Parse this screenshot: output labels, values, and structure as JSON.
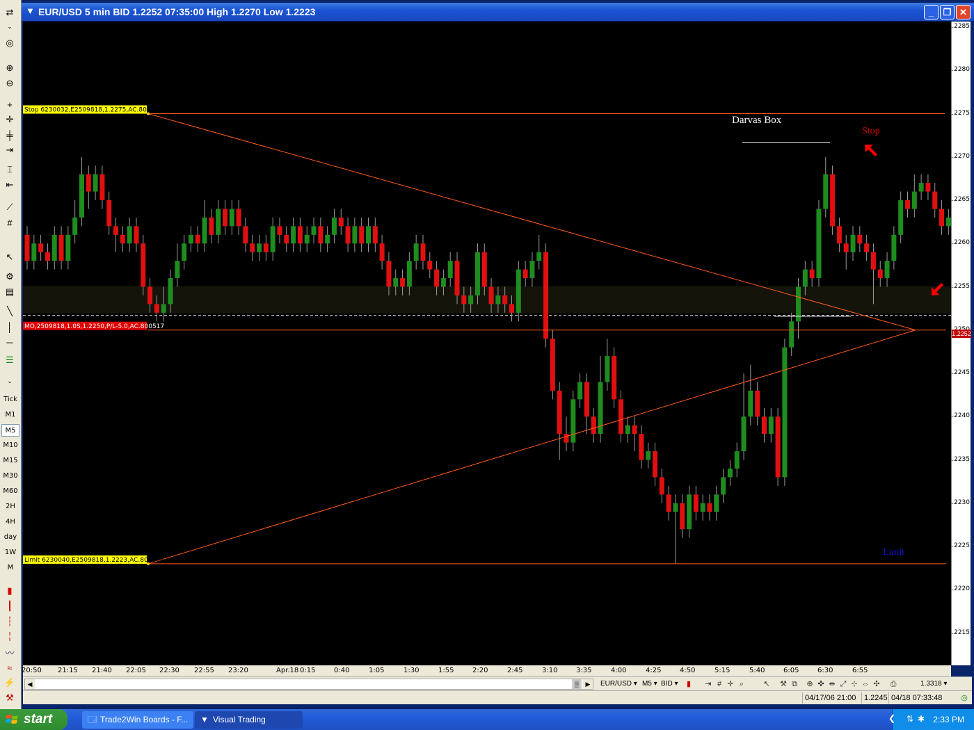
{
  "window": {
    "title": "EUR/USD 5 min BID 1.2252 07:35:00 High 1.2270 Low 1.2223",
    "minimize": "_",
    "restore": "❐",
    "close": "✕"
  },
  "toolbar": {
    "timeframes": [
      "Tick",
      "M1",
      "M5",
      "M10",
      "M15",
      "M30",
      "M60",
      "2H",
      "4H",
      "day",
      "1W",
      "M"
    ],
    "active_timeframe": "M5"
  },
  "chart": {
    "price_ticks": [
      "1.2285",
      "1.2280",
      "1.2275",
      "1.2270",
      "1.2265",
      "1.2260",
      "1.2255",
      "1.2250",
      "1.2245",
      "1.2240",
      "1.2235",
      "1.2230",
      "1.2225",
      "1.2220",
      "1.2215"
    ],
    "current_price": "1.2252",
    "time_ticks": [
      "20:50",
      "21:15",
      "21:40",
      "22:05",
      "22:30",
      "22:55",
      "23:20",
      "Apr.18",
      "0:15",
      "0:40",
      "1:05",
      "1:30",
      "1:55",
      "2:20",
      "2:45",
      "3:10",
      "3:35",
      "4:00",
      "4:25",
      "4:50",
      "5:15",
      "5:40",
      "6:05",
      "6:30",
      "6:55"
    ],
    "stop_label": "Stop 6230032,E2509818,1.2275,AC.800517",
    "order_label": "MO,2509818,1.0S,1.2250,P/L-5.0,AC.800517",
    "limit_label": "Limit 6230040,E2509818,1.2223,AC.800517",
    "annotation_darvas": "Darvas Box",
    "annotation_stop": "Stop",
    "annotation_limit": "Limit",
    "colors": {
      "up": "#1e8c1e",
      "down": "#e01010",
      "line": "#ff5a1e",
      "bg": "#000000"
    }
  },
  "chart_data": {
    "type": "candlestick",
    "title": "EUR/USD 5 min BID",
    "ylim": [
      1.2213,
      1.2286
    ],
    "candles": [
      [
        1.2261,
        1.2258,
        1.2262,
        1.2257
      ],
      [
        1.2258,
        1.226,
        1.2261,
        1.2257
      ],
      [
        1.226,
        1.2259,
        1.2261,
        1.2258
      ],
      [
        1.2259,
        1.2258,
        1.226,
        1.2257
      ],
      [
        1.2258,
        1.2261,
        1.2262,
        1.2257
      ],
      [
        1.2261,
        1.2258,
        1.2262,
        1.2257
      ],
      [
        1.2258,
        1.2261,
        1.2262,
        1.2257
      ],
      [
        1.2261,
        1.2263,
        1.2265,
        1.226
      ],
      [
        1.2263,
        1.2268,
        1.227,
        1.2262
      ],
      [
        1.2268,
        1.2266,
        1.2269,
        1.2264
      ],
      [
        1.2266,
        1.2268,
        1.2269,
        1.2265
      ],
      [
        1.2268,
        1.2265,
        1.2269,
        1.2264
      ],
      [
        1.2265,
        1.2262,
        1.2266,
        1.2261
      ],
      [
        1.2262,
        1.2261,
        1.2263,
        1.2259
      ],
      [
        1.2261,
        1.226,
        1.2262,
        1.2259
      ],
      [
        1.226,
        1.2262,
        1.2263,
        1.2259
      ],
      [
        1.2262,
        1.226,
        1.2263,
        1.2259
      ],
      [
        1.226,
        1.2255,
        1.2261,
        1.2254
      ],
      [
        1.2255,
        1.2253,
        1.2256,
        1.2252
      ],
      [
        1.2253,
        1.2252,
        1.2254,
        1.2251
      ],
      [
        1.2252,
        1.2253,
        1.2255,
        1.2251
      ],
      [
        1.2253,
        1.2256,
        1.2257,
        1.2252
      ],
      [
        1.2256,
        1.2258,
        1.226,
        1.2255
      ],
      [
        1.2258,
        1.226,
        1.2261,
        1.2257
      ],
      [
        1.226,
        1.2261,
        1.2262,
        1.2259
      ],
      [
        1.2261,
        1.226,
        1.2262,
        1.2259
      ],
      [
        1.226,
        1.2263,
        1.2265,
        1.2259
      ],
      [
        1.2263,
        1.2261,
        1.2264,
        1.226
      ],
      [
        1.2261,
        1.2264,
        1.2265,
        1.226
      ],
      [
        1.2264,
        1.2262,
        1.2265,
        1.2261
      ],
      [
        1.2262,
        1.2264,
        1.2265,
        1.2261
      ],
      [
        1.2264,
        1.2262,
        1.2265,
        1.2261
      ],
      [
        1.2262,
        1.226,
        1.2263,
        1.2259
      ],
      [
        1.226,
        1.2259,
        1.2261,
        1.2258
      ],
      [
        1.2259,
        1.226,
        1.2261,
        1.2258
      ],
      [
        1.226,
        1.2259,
        1.2261,
        1.2258
      ],
      [
        1.2259,
        1.2262,
        1.2263,
        1.2258
      ],
      [
        1.2262,
        1.2261,
        1.2263,
        1.226
      ],
      [
        1.2261,
        1.226,
        1.2262,
        1.2259
      ],
      [
        1.226,
        1.2262,
        1.2263,
        1.2259
      ],
      [
        1.2262,
        1.226,
        1.2263,
        1.2259
      ],
      [
        1.226,
        1.2261,
        1.2262,
        1.2259
      ],
      [
        1.2261,
        1.2262,
        1.2263,
        1.226
      ],
      [
        1.2262,
        1.226,
        1.2263,
        1.2259
      ],
      [
        1.226,
        1.2261,
        1.2262,
        1.2259
      ],
      [
        1.2261,
        1.2263,
        1.2264,
        1.226
      ],
      [
        1.2263,
        1.2262,
        1.2264,
        1.2261
      ],
      [
        1.2262,
        1.226,
        1.2263,
        1.2259
      ],
      [
        1.226,
        1.2262,
        1.2263,
        1.2259
      ],
      [
        1.2262,
        1.226,
        1.2263,
        1.2259
      ],
      [
        1.226,
        1.2262,
        1.2263,
        1.2259
      ],
      [
        1.2262,
        1.226,
        1.2263,
        1.2259
      ],
      [
        1.226,
        1.2258,
        1.2261,
        1.2257
      ],
      [
        1.2258,
        1.2255,
        1.2259,
        1.2254
      ],
      [
        1.2255,
        1.2256,
        1.2257,
        1.2254
      ],
      [
        1.2256,
        1.2255,
        1.2257,
        1.2254
      ],
      [
        1.2255,
        1.2258,
        1.2259,
        1.2254
      ],
      [
        1.2258,
        1.226,
        1.2261,
        1.2257
      ],
      [
        1.226,
        1.2258,
        1.2261,
        1.2257
      ],
      [
        1.2258,
        1.2257,
        1.2259,
        1.2256
      ],
      [
        1.2257,
        1.2255,
        1.2258,
        1.2254
      ],
      [
        1.2255,
        1.2256,
        1.2257,
        1.2254
      ],
      [
        1.2256,
        1.2258,
        1.2259,
        1.2255
      ],
      [
        1.2258,
        1.2254,
        1.2259,
        1.2253
      ],
      [
        1.2254,
        1.2253,
        1.2255,
        1.2252
      ],
      [
        1.2253,
        1.2254,
        1.2255,
        1.2252
      ],
      [
        1.2254,
        1.2259,
        1.226,
        1.2253
      ],
      [
        1.2259,
        1.2255,
        1.226,
        1.2254
      ],
      [
        1.2255,
        1.2253,
        1.2256,
        1.2252
      ],
      [
        1.2253,
        1.2254,
        1.2255,
        1.2252
      ],
      [
        1.2254,
        1.2253,
        1.2255,
        1.2252
      ],
      [
        1.2253,
        1.2252,
        1.2254,
        1.2251
      ],
      [
        1.2252,
        1.2257,
        1.2258,
        1.2251
      ],
      [
        1.2257,
        1.2256,
        1.2258,
        1.2255
      ],
      [
        1.2256,
        1.2258,
        1.2259,
        1.2255
      ],
      [
        1.2258,
        1.2259,
        1.2261,
        1.2257
      ],
      [
        1.2259,
        1.2249,
        1.226,
        1.2248
      ],
      [
        1.2249,
        1.2243,
        1.225,
        1.2242
      ],
      [
        1.2243,
        1.2238,
        1.2244,
        1.2235
      ],
      [
        1.2238,
        1.2237,
        1.224,
        1.2236
      ],
      [
        1.2237,
        1.2242,
        1.2243,
        1.2236
      ],
      [
        1.2242,
        1.2244,
        1.2245,
        1.2241
      ],
      [
        1.2244,
        1.224,
        1.2245,
        1.2238
      ],
      [
        1.224,
        1.2238,
        1.2241,
        1.2237
      ],
      [
        1.2238,
        1.2244,
        1.2247,
        1.2237
      ],
      [
        1.2244,
        1.2247,
        1.2249,
        1.2243
      ],
      [
        1.2247,
        1.2242,
        1.2248,
        1.2241
      ],
      [
        1.2242,
        1.2238,
        1.2243,
        1.2237
      ],
      [
        1.2238,
        1.2239,
        1.224,
        1.2237
      ],
      [
        1.2239,
        1.2238,
        1.224,
        1.2236
      ],
      [
        1.2238,
        1.2235,
        1.2239,
        1.2234
      ],
      [
        1.2235,
        1.2236,
        1.2237,
        1.2234
      ],
      [
        1.2236,
        1.2233,
        1.2237,
        1.2232
      ],
      [
        1.2233,
        1.2231,
        1.2234,
        1.223
      ],
      [
        1.2231,
        1.2229,
        1.2232,
        1.2228
      ],
      [
        1.2229,
        1.223,
        1.2231,
        1.2223
      ],
      [
        1.223,
        1.2227,
        1.2231,
        1.2226
      ],
      [
        1.2227,
        1.2231,
        1.2232,
        1.2226
      ],
      [
        1.2231,
        1.2229,
        1.2232,
        1.2228
      ],
      [
        1.2229,
        1.223,
        1.2231,
        1.2228
      ],
      [
        1.223,
        1.2229,
        1.2231,
        1.2228
      ],
      [
        1.2229,
        1.2231,
        1.2232,
        1.2228
      ],
      [
        1.2231,
        1.2233,
        1.2234,
        1.223
      ],
      [
        1.2233,
        1.2234,
        1.2235,
        1.2232
      ],
      [
        1.2234,
        1.2236,
        1.2237,
        1.2233
      ],
      [
        1.2236,
        1.224,
        1.2245,
        1.2235
      ],
      [
        1.224,
        1.2243,
        1.2246,
        1.2239
      ],
      [
        1.2243,
        1.224,
        1.2244,
        1.2239
      ],
      [
        1.224,
        1.2238,
        1.2241,
        1.2237
      ],
      [
        1.2238,
        1.224,
        1.2241,
        1.2237
      ],
      [
        1.224,
        1.2233,
        1.2241,
        1.2232
      ],
      [
        1.2233,
        1.2248,
        1.2249,
        1.2232
      ],
      [
        1.2248,
        1.2251,
        1.2252,
        1.2247
      ],
      [
        1.2251,
        1.2255,
        1.2256,
        1.2249
      ],
      [
        1.2255,
        1.2257,
        1.2258,
        1.2254
      ],
      [
        1.2257,
        1.2256,
        1.2258,
        1.2255
      ],
      [
        1.2256,
        1.2264,
        1.2265,
        1.2255
      ],
      [
        1.2264,
        1.2268,
        1.227,
        1.2263
      ],
      [
        1.2268,
        1.2262,
        1.2269,
        1.2261
      ],
      [
        1.2262,
        1.226,
        1.2263,
        1.2259
      ],
      [
        1.226,
        1.2259,
        1.2261,
        1.2257
      ],
      [
        1.2259,
        1.2261,
        1.2262,
        1.2258
      ],
      [
        1.2261,
        1.226,
        1.2262,
        1.2259
      ],
      [
        1.226,
        1.2259,
        1.2261,
        1.2258
      ],
      [
        1.2259,
        1.2257,
        1.226,
        1.2253
      ],
      [
        1.2257,
        1.2256,
        1.2258,
        1.2255
      ],
      [
        1.2256,
        1.2258,
        1.2259,
        1.2255
      ],
      [
        1.2258,
        1.2261,
        1.2262,
        1.2257
      ],
      [
        1.2261,
        1.2265,
        1.2266,
        1.226
      ],
      [
        1.2265,
        1.2264,
        1.2266,
        1.2263
      ],
      [
        1.2264,
        1.2266,
        1.2268,
        1.2263
      ],
      [
        1.2266,
        1.2267,
        1.2268,
        1.2265
      ],
      [
        1.2267,
        1.2266,
        1.2268,
        1.2265
      ],
      [
        1.2266,
        1.2264,
        1.2267,
        1.2263
      ],
      [
        1.2264,
        1.2262,
        1.2265,
        1.2261
      ],
      [
        1.2262,
        1.2263,
        1.2264,
        1.2261
      ],
      [
        1.2263,
        1.2261,
        1.2264,
        1.226
      ],
      [
        1.2261,
        1.2262,
        1.2263,
        1.226
      ],
      [
        1.2262,
        1.2261,
        1.2263,
        1.226
      ],
      [
        1.2261,
        1.2258,
        1.2262,
        1.2257
      ],
      [
        1.2258,
        1.2257,
        1.2259,
        1.2256
      ],
      [
        1.2257,
        1.2256,
        1.2258,
        1.2255
      ],
      [
        1.2256,
        1.2258,
        1.2259,
        1.2255
      ],
      [
        1.2258,
        1.2257,
        1.2259,
        1.2256
      ],
      [
        1.2257,
        1.2259,
        1.226,
        1.2256
      ],
      [
        1.2259,
        1.2261,
        1.2262,
        1.2258
      ],
      [
        1.2261,
        1.226,
        1.2262,
        1.2259
      ],
      [
        1.226,
        1.2259,
        1.2261,
        1.2258
      ],
      [
        1.2259,
        1.2258,
        1.226,
        1.2257
      ],
      [
        1.2258,
        1.2256,
        1.2259,
        1.2255
      ],
      [
        1.2256,
        1.2253,
        1.2257,
        1.2252
      ],
      [
        1.2253,
        1.2252,
        1.2254,
        1.225
      ]
    ]
  },
  "scrollbar": {
    "symbol": "EUR/USD ▾",
    "period": "M5 ▾",
    "side": "BID ▾",
    "zoom": "1.3318 ▾"
  },
  "status": {
    "range": "04/17/06 21:00",
    "value": "1.2245",
    "time": "04/18 07:33:48"
  },
  "taskbar": {
    "start": "start",
    "task1": "Trade2Win Boards - F...",
    "task2": "Visual Trading",
    "clock": "2:33 PM"
  }
}
